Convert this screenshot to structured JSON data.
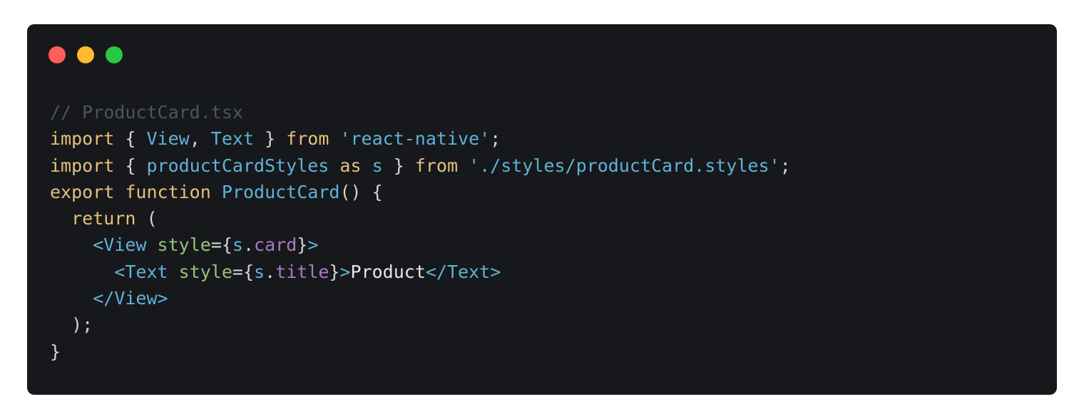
{
  "window": {
    "traffic_lights": [
      {
        "name": "close",
        "color": "#ff5f57"
      },
      {
        "name": "minimize",
        "color": "#febc2e"
      },
      {
        "name": "zoom",
        "color": "#28c840"
      }
    ]
  },
  "code": {
    "lines": [
      [
        {
          "t": "comment",
          "v": "// ProductCard.tsx"
        }
      ],
      [
        {
          "t": "keyword",
          "v": "import"
        },
        {
          "t": "punct",
          "v": " { "
        },
        {
          "t": "ident",
          "v": "View"
        },
        {
          "t": "punct",
          "v": ", "
        },
        {
          "t": "ident",
          "v": "Text"
        },
        {
          "t": "punct",
          "v": " } "
        },
        {
          "t": "keyword",
          "v": "from"
        },
        {
          "t": "punct",
          "v": " "
        },
        {
          "t": "string",
          "v": "'react-native'"
        },
        {
          "t": "punct",
          "v": ";"
        }
      ],
      [
        {
          "t": "keyword",
          "v": "import"
        },
        {
          "t": "punct",
          "v": " { "
        },
        {
          "t": "ident",
          "v": "productCardStyles"
        },
        {
          "t": "punct",
          "v": " "
        },
        {
          "t": "keyword",
          "v": "as"
        },
        {
          "t": "punct",
          "v": " "
        },
        {
          "t": "ident",
          "v": "s"
        },
        {
          "t": "punct",
          "v": " } "
        },
        {
          "t": "keyword",
          "v": "from"
        },
        {
          "t": "punct",
          "v": " "
        },
        {
          "t": "string",
          "v": "'./styles/productCard.styles'"
        },
        {
          "t": "punct",
          "v": ";"
        }
      ],
      [
        {
          "t": "keyword",
          "v": "export"
        },
        {
          "t": "punct",
          "v": " "
        },
        {
          "t": "keyword",
          "v": "function"
        },
        {
          "t": "punct",
          "v": " "
        },
        {
          "t": "fn",
          "v": "ProductCard"
        },
        {
          "t": "punct",
          "v": "() {"
        }
      ],
      [
        {
          "t": "punct",
          "v": "  "
        },
        {
          "t": "keyword",
          "v": "return"
        },
        {
          "t": "punct",
          "v": " ("
        }
      ],
      [
        {
          "t": "punct",
          "v": "    "
        },
        {
          "t": "tag",
          "v": "<View"
        },
        {
          "t": "punct",
          "v": " "
        },
        {
          "t": "attr",
          "v": "style"
        },
        {
          "t": "punct",
          "v": "={"
        },
        {
          "t": "ident",
          "v": "s"
        },
        {
          "t": "punct",
          "v": "."
        },
        {
          "t": "prop",
          "v": "card"
        },
        {
          "t": "punct",
          "v": "}"
        },
        {
          "t": "tag",
          "v": ">"
        }
      ],
      [
        {
          "t": "punct",
          "v": "      "
        },
        {
          "t": "tag",
          "v": "<Text"
        },
        {
          "t": "punct",
          "v": " "
        },
        {
          "t": "attr",
          "v": "style"
        },
        {
          "t": "punct",
          "v": "={"
        },
        {
          "t": "ident",
          "v": "s"
        },
        {
          "t": "punct",
          "v": "."
        },
        {
          "t": "prop",
          "v": "title"
        },
        {
          "t": "punct",
          "v": "}"
        },
        {
          "t": "tag",
          "v": ">"
        },
        {
          "t": "text",
          "v": "Product"
        },
        {
          "t": "tag",
          "v": "</Text>"
        }
      ],
      [
        {
          "t": "punct",
          "v": "    "
        },
        {
          "t": "tag",
          "v": "</View>"
        }
      ],
      [
        {
          "t": "punct",
          "v": "  );"
        }
      ],
      [
        {
          "t": "punct",
          "v": "}"
        }
      ]
    ]
  }
}
